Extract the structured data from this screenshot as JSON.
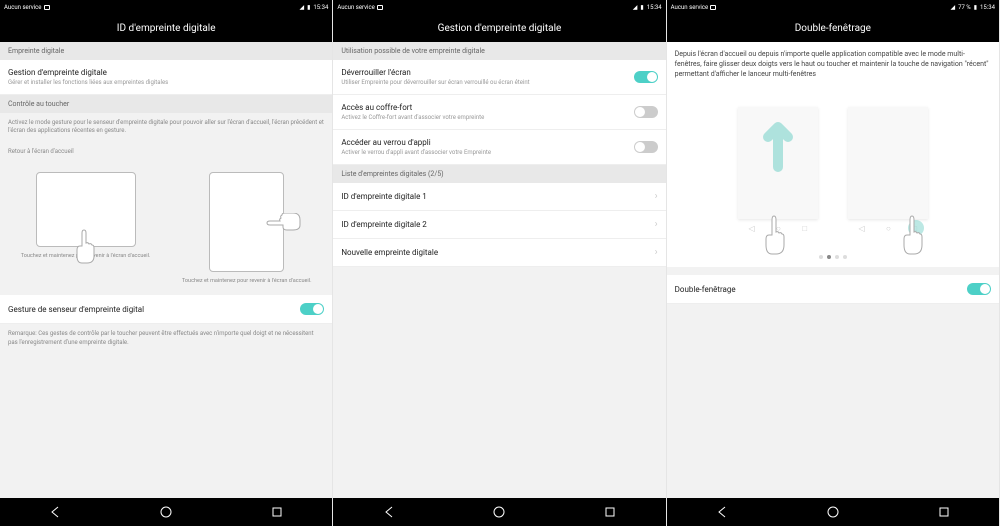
{
  "status": {
    "carrier": "Aucun service",
    "battery": "77 %",
    "time": "15:34"
  },
  "screen1": {
    "title": "ID d'empreinte digitale",
    "sec1": "Empreinte digitale",
    "item1_title": "Gestion d'empreinte digitale",
    "item1_sub": "Gérer et installer les fonctions liées aux empreintes digitales",
    "sec2": "Contrôle au toucher",
    "note1": "Activez le mode gesture pour le senseur d'empreinte digitale pour pouvoir aller sur l'écran d'accueil, l'écran précédent et l'écran des applications récentes en gesture.",
    "note2": "Retour à l'écran d'accueil",
    "cap1": "Touchez et maintenez pour revenir à l'écran d'accueil.",
    "cap2": "Touchez et maintenez pour revenir à l'écran d'accueil.",
    "toggle_label": "Gesture de senseur d'empreinte digital",
    "note3": "Remarque: Ces gestes de contrôle par le toucher peuvent être effectués avec n'importe quel doigt et ne nécessitent pas l'enregistrement d'une empreinte digitale."
  },
  "screen2": {
    "title": "Gestion d'empreinte digitale",
    "sec1": "Utilisation possible de votre empreinte digitale",
    "item1_title": "Déverrouiller l'écran",
    "item1_sub": "Utiliser Empreinte pour déverrouiller sur écran verrouillé ou écran éteint",
    "item2_title": "Accès au coffre-fort",
    "item2_sub": "Activez le Coffre-fort avant d'associer votre empreinte",
    "item3_title": "Accéder au verrou d'appli",
    "item3_sub": "Activer le verrou d'appli avant d'associer votre Empreinte",
    "sec2": "Liste d'empreintes digitales (2/5)",
    "fp1": "ID d'empreinte digitale 1",
    "fp2": "ID d'empreinte digitale 2",
    "new_fp": "Nouvelle empreinte digitale"
  },
  "screen3": {
    "title": "Double-fenêtrage",
    "desc": "Depuis l'écran d'accueil ou depuis n'importe quelle application compatible avec le mode multi-fenêtres, faire glisser deux doigts vers le haut ou toucher et maintenir la touche de navigation \"récent\" permettant d'afficher le lanceur multi-fenêtres",
    "toggle_label": "Double-fenêtrage"
  }
}
